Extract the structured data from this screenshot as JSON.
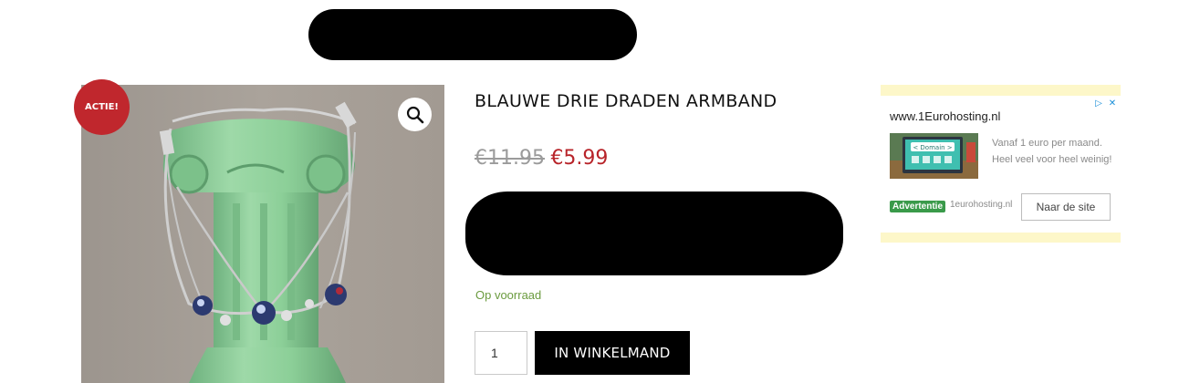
{
  "product": {
    "title": "BLAUWE DRIE DRADEN ARMBAND",
    "price_old": "€11.95",
    "price_new": "€5.99",
    "stock_status": "Op voorraad",
    "sale_badge": "ACTIE!",
    "quantity": "1",
    "add_to_cart_label": "IN WINKELMAND",
    "image_icon": "zoom-magnifier-icon"
  },
  "ad": {
    "url": "www.1Eurohosting.nl",
    "text": "Vanaf 1 euro per maand. Heel veel voor heel weinig!",
    "label": "Advertentie",
    "domain": "1eurohosting.nl",
    "cta": "Naar de site",
    "thumb_text": "< Domain >",
    "choices_icons": [
      "ad-choices-icon",
      "close-icon"
    ]
  },
  "colors": {
    "sale_red": "#c0272d",
    "price_red": "#b8242a",
    "stock_green": "#6b9b3f",
    "ad_background": "#fdf7c9",
    "ad_label_green": "#3a9a4a",
    "ad_choices_blue": "#1a8fd8",
    "button_black": "#000000"
  }
}
